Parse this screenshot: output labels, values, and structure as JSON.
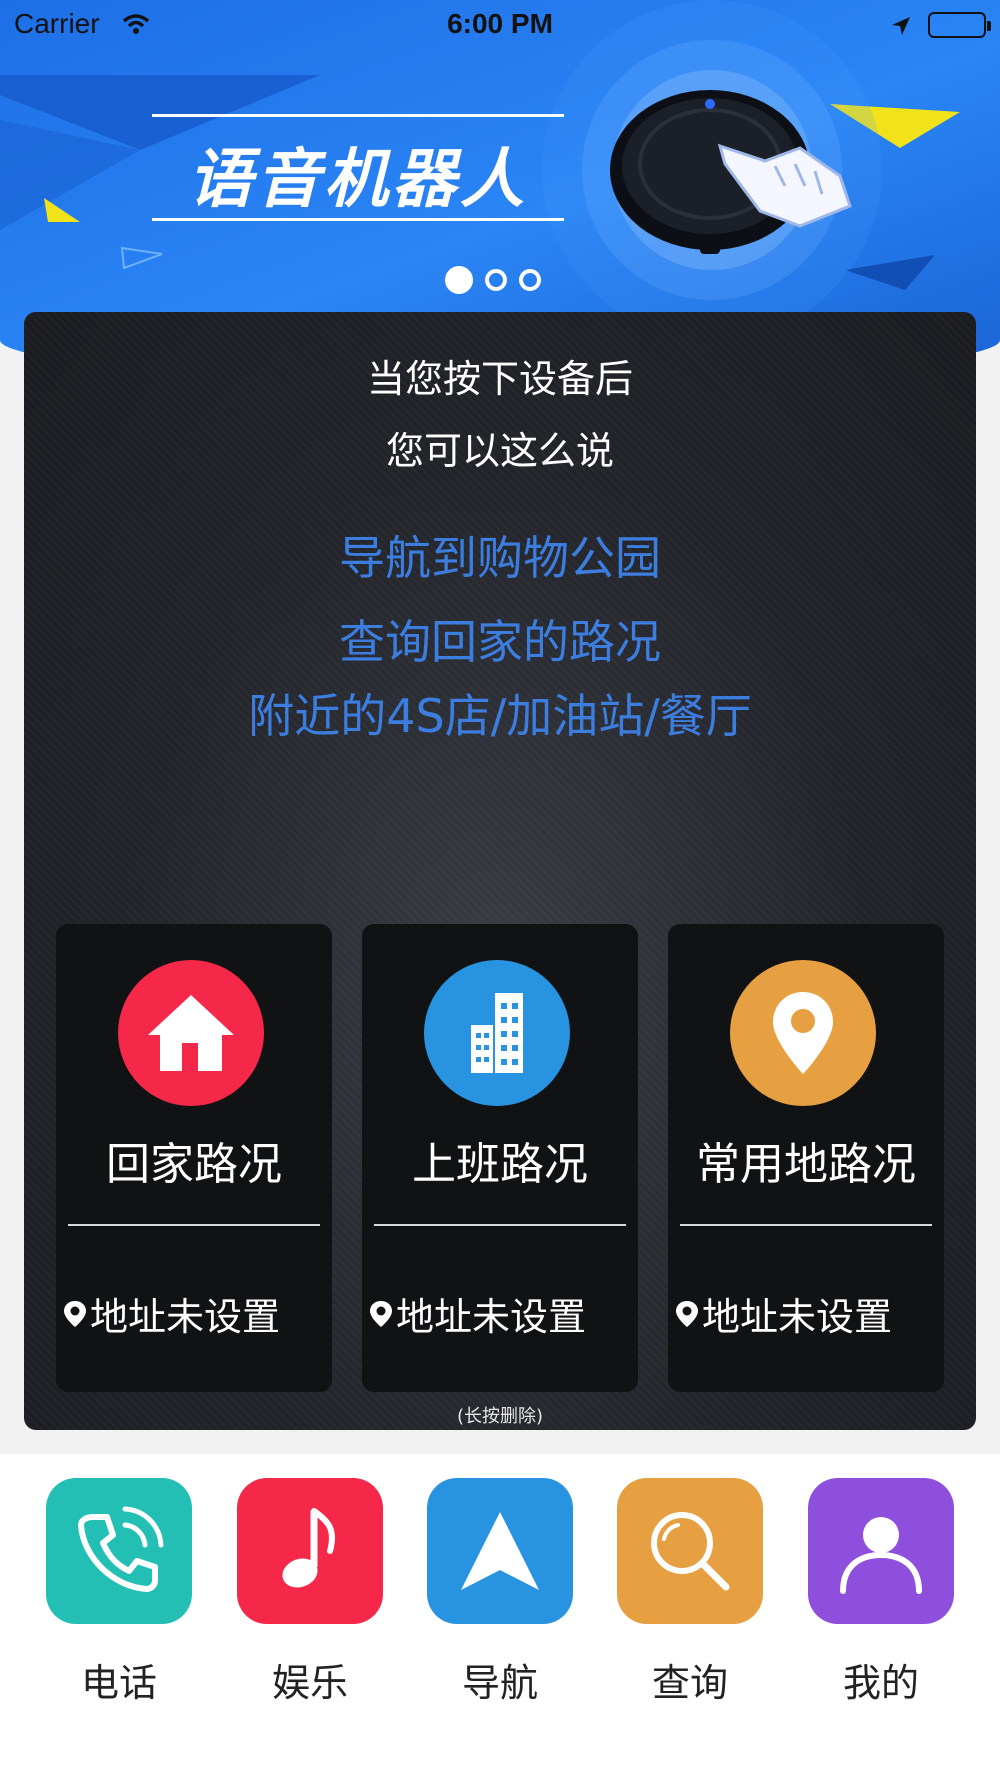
{
  "status_bar": {
    "carrier": "Carrier",
    "time": "6:00 PM"
  },
  "banner": {
    "title": "语音机器人",
    "page_count": 3,
    "active_page": 1
  },
  "card": {
    "prompt_line1": "当您按下设备后",
    "prompt_line2": "您可以这么说",
    "examples": [
      "导航到购物公园",
      "查询回家的路况",
      "附近的4S店/加油站/餐厅"
    ],
    "tiles": [
      {
        "label": "回家路况",
        "address": "地址未设置",
        "icon": "home-icon",
        "color": "#f5284a"
      },
      {
        "label": "上班路况",
        "address": "地址未设置",
        "icon": "building-icon",
        "color": "#2893e0"
      },
      {
        "label": "常用地路况",
        "address": "地址未设置",
        "icon": "location-pin-icon",
        "color": "#e7a041"
      }
    ],
    "hint": "(长按删除)"
  },
  "tabbar": {
    "items": [
      {
        "label": "电话",
        "icon": "phone-icon",
        "color": "#23bfb4"
      },
      {
        "label": "娱乐",
        "icon": "music-note-icon",
        "color": "#f5284a"
      },
      {
        "label": "导航",
        "icon": "navigation-arrow-icon",
        "color": "#2893e0"
      },
      {
        "label": "查询",
        "icon": "search-icon",
        "color": "#e7a041"
      },
      {
        "label": "我的",
        "icon": "user-icon",
        "color": "#8e4fdc"
      }
    ]
  },
  "colors": {
    "banner_blue": "#2a85f5",
    "example_text": "#3c7ee0",
    "card_bg": "#25272c"
  }
}
